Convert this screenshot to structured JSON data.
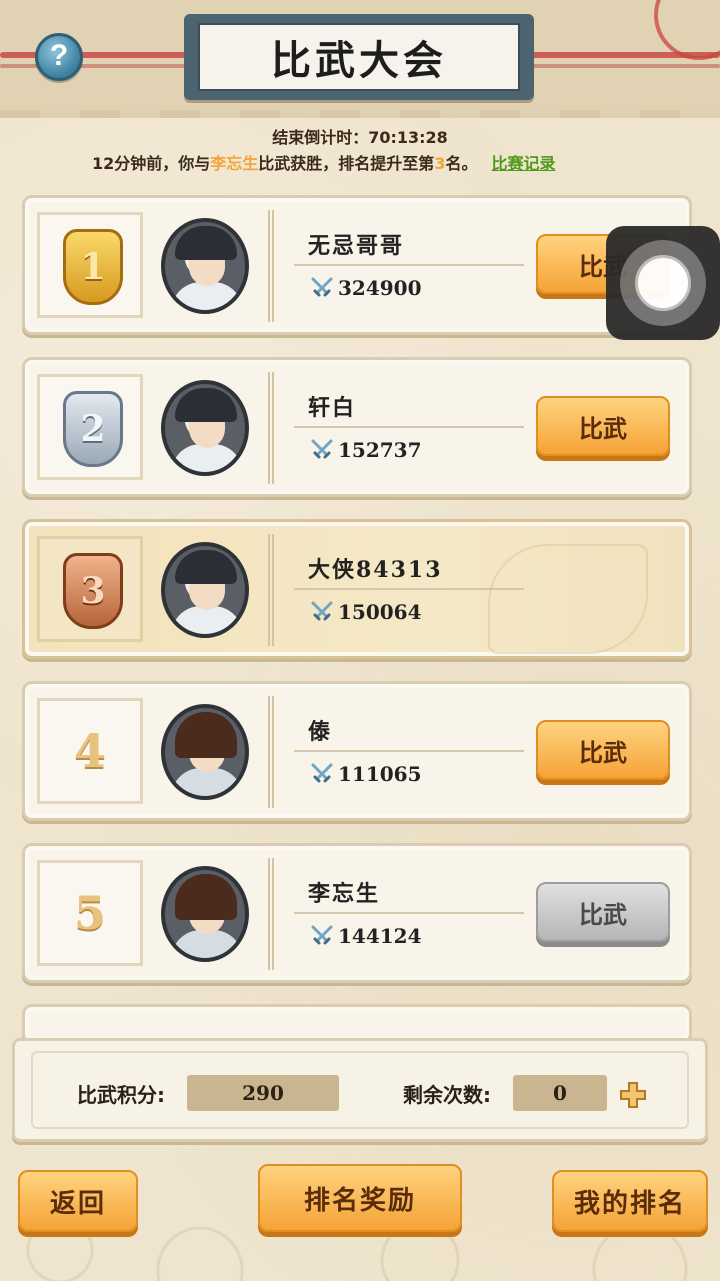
{
  "header": {
    "title": "比武大会",
    "help_label": "?"
  },
  "countdown": {
    "label": "结束倒计时：",
    "value": "70:13:28"
  },
  "news": {
    "prefix": "12分钟前，你与",
    "opponent": "李忘生",
    "middle": "比武获胜，排名提升至第",
    "rank": "3",
    "suffix": "名。",
    "record_link": "比赛记录"
  },
  "rankings": [
    {
      "rank": "1",
      "medal": "gold",
      "name": "无忌哥哥",
      "power": "324900",
      "button": "比武",
      "button_state": "active",
      "avatar": "dark"
    },
    {
      "rank": "2",
      "medal": "silver",
      "name": "轩白",
      "power": "152737",
      "button": "比武",
      "button_state": "active",
      "avatar": "dark"
    },
    {
      "rank": "3",
      "medal": "bronze",
      "name": "大侠84313",
      "power": "150064",
      "button": "",
      "button_state": "self",
      "avatar": "dark"
    },
    {
      "rank": "4",
      "medal": "none",
      "name": "傣",
      "power": "111065",
      "button": "比武",
      "button_state": "active",
      "avatar": "brown"
    },
    {
      "rank": "5",
      "medal": "none",
      "name": "李忘生",
      "power": "144124",
      "button": "比武",
      "button_state": "disabled",
      "avatar": "brown"
    }
  ],
  "stats": {
    "points_label": "比武积分:",
    "points_value": "290",
    "remaining_label": "剩余次数:",
    "remaining_value": "0"
  },
  "buttons": {
    "back": "返回",
    "rewards": "排名奖励",
    "my_rank": "我的排名"
  },
  "colors": {
    "accent_orange": "#f5a336",
    "highlight_name": "#f2a53a",
    "record_link": "#4f9a1a"
  }
}
